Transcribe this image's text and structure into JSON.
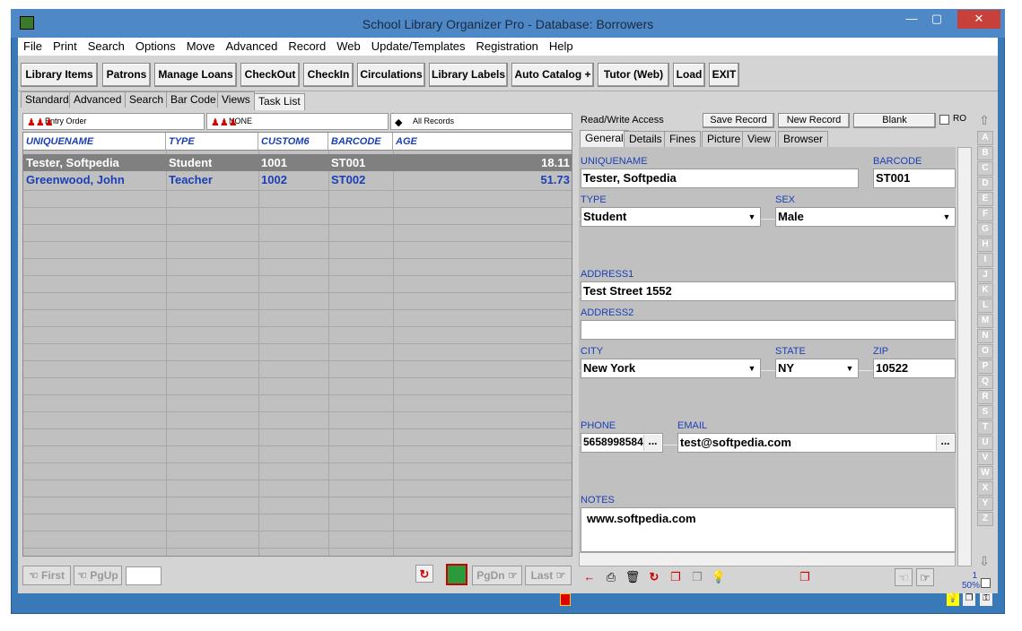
{
  "window": {
    "title": "School Library Organizer Pro - Database: Borrowers",
    "minimize": "—",
    "maximize": "▢",
    "close": "✕"
  },
  "menu": [
    "File",
    "Print",
    "Search",
    "Options",
    "Move",
    "Advanced",
    "Record",
    "Web",
    "Update/Templates",
    "Registration",
    "Help"
  ],
  "toolbar": {
    "buttons": [
      "Library Items",
      "Patrons",
      "Manage Loans",
      "CheckOut",
      "CheckIn",
      "Circulations",
      "Library Labels",
      "Auto Catalog +",
      "Tutor (Web)",
      "Load",
      "EXIT"
    ]
  },
  "subtabs": [
    "Standard",
    "Advanced",
    "Search",
    "Bar Code",
    "Views",
    "Task List"
  ],
  "selectors": {
    "order": "Entry Order",
    "filter": "NONE",
    "records": "All Records"
  },
  "grid": {
    "headers": [
      "UNIQUENAME",
      "TYPE",
      "CUSTOM6",
      "BARCODE",
      "AGE"
    ],
    "rows": [
      {
        "name": "Tester, Softpedia",
        "type": "Student",
        "custom6": "1001",
        "barcode": "ST001",
        "age": "18.11"
      },
      {
        "name": "Greenwood,  John",
        "type": "Teacher",
        "custom6": "1002",
        "barcode": "ST002",
        "age": "51.73"
      }
    ]
  },
  "nav": {
    "first": "First",
    "pgup": "PgUp",
    "pgdn": "PgDn",
    "last": "Last"
  },
  "record": {
    "access": "Read/Write Access",
    "save": "Save Record",
    "new": "New Record",
    "blank": "Blank",
    "ro": "RO"
  },
  "record_tabs": [
    "General",
    "Details",
    "Fines",
    "Picture",
    "View",
    "Browser"
  ],
  "form": {
    "uniquename_label": "UNIQUENAME",
    "uniquename": "Tester, Softpedia",
    "barcode_label": "BARCODE",
    "barcode": "ST001",
    "type_label": "TYPE",
    "type": "Student",
    "sex_label": "SEX",
    "sex": "Male",
    "address1_label": "ADDRESS1",
    "address1": "Test Street 1552",
    "address2_label": "ADDRESS2",
    "address2": "",
    "city_label": "CITY",
    "city": "New York",
    "state_label": "STATE",
    "state": "NY",
    "zip_label": "ZIP",
    "zip": "10522",
    "phone_label": "PHONE",
    "phone": "5658998584",
    "email_label": "EMAIL",
    "email": "test@softpedia.com",
    "notes_label": "NOTES",
    "notes": "www.softpedia.com"
  },
  "alphabet": [
    "A",
    "B",
    "C",
    "D",
    "E",
    "F",
    "G",
    "H",
    "I",
    "J",
    "K",
    "L",
    "M",
    "N",
    "O",
    "P",
    "Q",
    "R",
    "S",
    "T",
    "U",
    "V",
    "W",
    "X",
    "Y",
    "Z"
  ],
  "status": {
    "page": "1",
    "zoom": "50%"
  },
  "colors": {
    "window_frame": "#3a79b8",
    "selected_row": "#808080",
    "link_blue": "#1a3fb5"
  }
}
